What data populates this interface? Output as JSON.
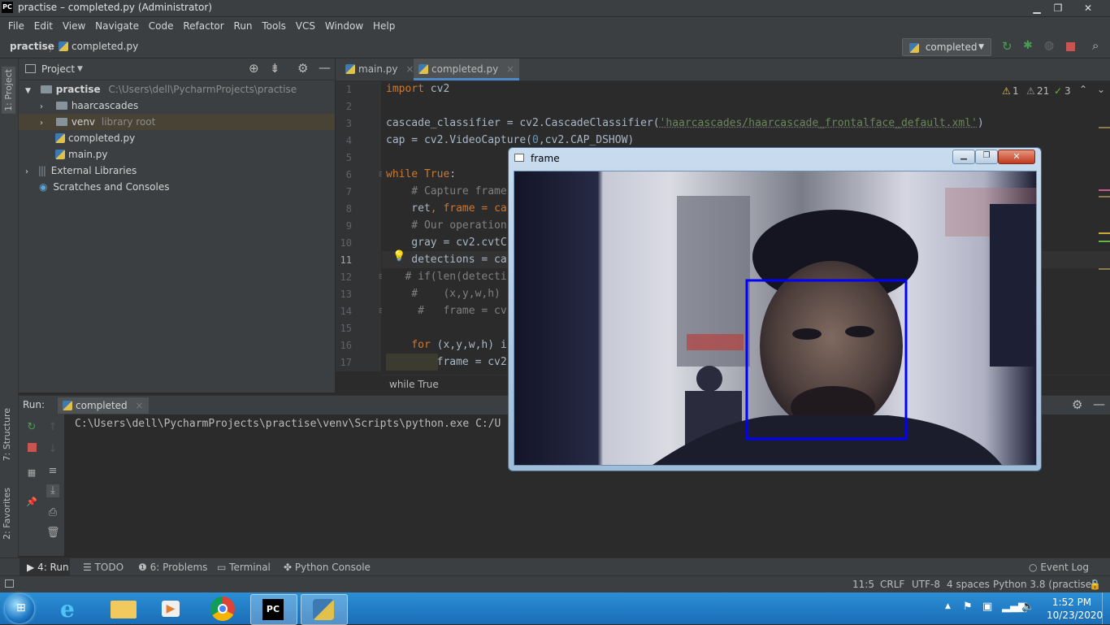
{
  "titlebar": {
    "title": "practise – completed.py (Administrator)",
    "minimize": "▁",
    "maximize": "❐",
    "close": "✕"
  },
  "menu": [
    "File",
    "Edit",
    "View",
    "Navigate",
    "Code",
    "Refactor",
    "Run",
    "Tools",
    "VCS",
    "Window",
    "Help"
  ],
  "nav": {
    "project": "practise",
    "file": "completed.py",
    "run_config": "completed"
  },
  "leftstrip": {
    "project_tab": "1: Project",
    "structure_tab": "7: Structure",
    "favorites_tab": "2: Favorites"
  },
  "project_panel": {
    "title": "Project",
    "tree": [
      {
        "label": "practise",
        "path": "C:\\Users\\dell\\PycharmProjects\\practise"
      },
      {
        "label": "haarcascades"
      },
      {
        "label": "venv",
        "note": "library root"
      },
      {
        "label": "completed.py"
      },
      {
        "label": "main.py"
      },
      {
        "label": "External Libraries"
      },
      {
        "label": "Scratches and Consoles"
      }
    ]
  },
  "editor": {
    "tabs": [
      {
        "label": "main.py"
      },
      {
        "label": "completed.py"
      }
    ],
    "inspections": {
      "warn1": "1",
      "warn2": "21",
      "ok": "3"
    },
    "lines": [
      "1",
      "2",
      "3",
      "4",
      "5",
      "6",
      "7",
      "8",
      "9",
      "10",
      "11",
      "12",
      "13",
      "14",
      "15",
      "16",
      "17"
    ],
    "code": {
      "l1_kw": "import",
      "l1_rest": " cv2",
      "l3_a": "cascade_classifier = cv2.CascadeClassifier(",
      "l3_str": "'haarcascades/haarcascade_frontalface_default.xml'",
      "l3_b": ")",
      "l4_a": "cap = cv2.VideoCapture(",
      "l4_num": "0",
      "l4_b": ",cv2.CAP_DSHOW)",
      "l6_kw": "while",
      "l6_kw2": " True",
      "l6_b": ":",
      "l7": "    # Capture frame",
      "l8_a": "    ret",
      "l8_b": ", frame = ca",
      "l9": "    # Our operation",
      "l10": "    gray = cv2.cvtC",
      "l11": "    detections = ca",
      "l12": "   # if(len(detecti",
      "l13": "    #    (x,y,w,h)",
      "l14": "     #   frame = cv",
      "l16_kw": "    for",
      "l16_b": " (x,y,w,h) i",
      "l17": "        frame = cv2"
    },
    "breadcrumb": "while True"
  },
  "run_panel": {
    "label": "Run:",
    "tab": "completed",
    "output": "C:\\Users\\dell\\PycharmProjects\\practise\\venv\\Scripts\\python.exe C:/U"
  },
  "bottom_tools": [
    {
      "label": "4: Run"
    },
    {
      "label": "TODO"
    },
    {
      "label": "6: Problems"
    },
    {
      "label": "Terminal"
    },
    {
      "label": "Python Console"
    }
  ],
  "event_log": "Event Log",
  "status": {
    "position": "11:5",
    "line_sep": "CRLF",
    "encoding": "UTF-8",
    "indent": "4 spaces",
    "interpreter": "Python 3.8 (practise)"
  },
  "frame_window": {
    "title": "frame"
  },
  "taskbar": {
    "time": "1:52 PM",
    "date": "10/23/2020"
  },
  "colors": {
    "accent": "#4a88c7",
    "editor_bg": "#2b2b2b",
    "panel_bg": "#3c3f41",
    "keyword": "#cc7832",
    "string": "#6a8759",
    "detection_box": "#0000ff"
  }
}
